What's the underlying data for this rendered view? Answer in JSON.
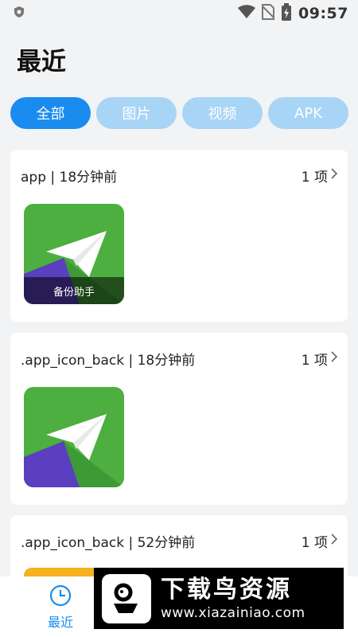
{
  "status_bar": {
    "time": "09:57"
  },
  "header": {
    "title": "最近"
  },
  "tabs": [
    {
      "label": "全部",
      "active": true
    },
    {
      "label": "图片",
      "active": false
    },
    {
      "label": "视频",
      "active": false
    },
    {
      "label": "APK",
      "active": false
    }
  ],
  "cards": [
    {
      "title": "app | 18分钟前",
      "count": "1 项",
      "thumb_label": "备份助手"
    },
    {
      "title": ".app_icon_back | 18分钟前",
      "count": "1 项"
    },
    {
      "title": ".app_icon_back | 52分钟前",
      "count": "1 项"
    }
  ],
  "bottom_nav": {
    "recent_label": "最近"
  },
  "watermark": {
    "title": "下载鸟资源",
    "url": "www.xiazainiao.com"
  },
  "colors": {
    "accent": "#1a8cf0",
    "tab_inactive": "#a8d4f6",
    "icon_green": "#4caf3f",
    "icon_purple": "#5a3fc0",
    "background": "#f2f3f5"
  },
  "icons": [
    "shield-icon",
    "wifi-icon",
    "no-sim-icon",
    "battery-icon",
    "chevron-right-icon",
    "paper-plane-icon",
    "clock-icon"
  ]
}
